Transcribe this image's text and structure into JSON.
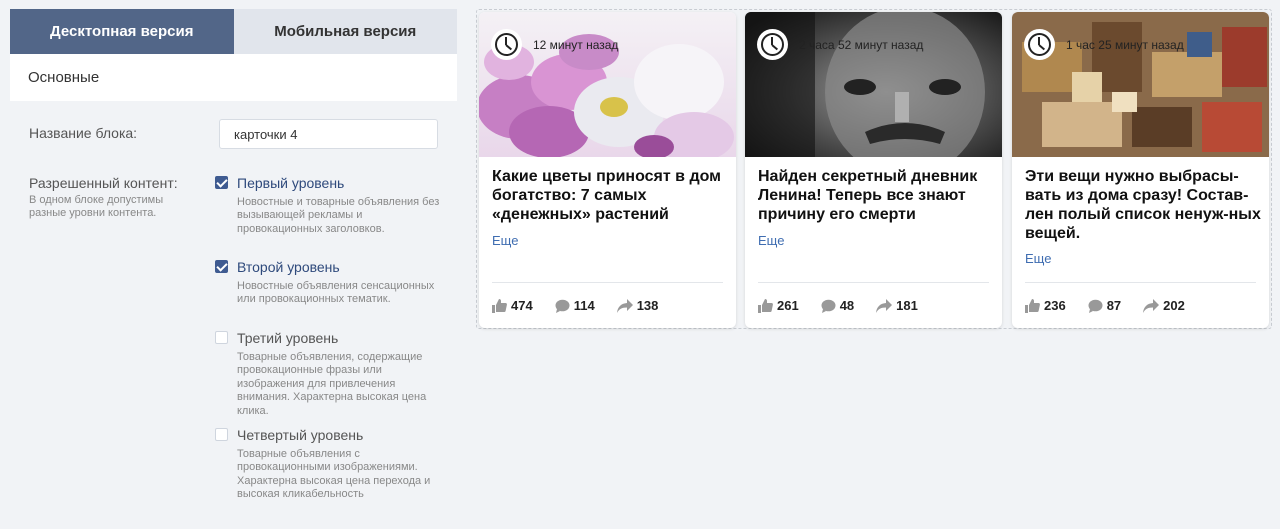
{
  "tabs": {
    "desktop": "Десктопная версия",
    "mobile": "Мобильная версия"
  },
  "section": "Основные",
  "block_name": {
    "label": "Название блока:",
    "value": "карточки 4"
  },
  "content": {
    "label": "Разрешенный контент:",
    "hint": "В одном блоке допустимы разные уровни контента.",
    "levels": [
      {
        "title": "Первый уровень",
        "checked": true,
        "desc": "Новостные и товарные объявления без вызывающей рекламы и провокационных заголовков."
      },
      {
        "title": "Второй уровень",
        "checked": true,
        "desc": "Новостные объявления сенсационных или провокационных тематик."
      },
      {
        "title": "Третий уровень",
        "checked": false,
        "desc": "Товарные объявления, содержащие провокационные фразы или изображения для привлечения внимания. Характерна высокая цена клика."
      },
      {
        "title": "Четвертый уровень",
        "checked": false,
        "desc": "Товарные объявления с провокационными изображениями. Характерна высокая цена перехода и высокая кликабельность"
      }
    ]
  },
  "cards": [
    {
      "time": "12 минут назад",
      "title": "Какие цветы приносят в дом богатство: 7 самых «денежных» растений",
      "more": "Еще",
      "likes": "474",
      "comments": "114",
      "shares": "138"
    },
    {
      "time": "2 часа 52 минут назад",
      "title": "Найден секретный дневник Ленина! Теперь все знают причину его смерти",
      "more": "Еще",
      "likes": "261",
      "comments": "48",
      "shares": "181"
    },
    {
      "time": "1 час 25 минут назад",
      "title": "Эти вещи нужно выбрасы-вать из дома сразу! Состав-лен полый список ненуж-ных вещей.",
      "more": "Еще",
      "likes": "236",
      "comments": "87",
      "shares": "202"
    }
  ],
  "colors": {
    "tab_active": "#526688",
    "checkbox": "#3f5b91",
    "link": "#3f6db1"
  }
}
